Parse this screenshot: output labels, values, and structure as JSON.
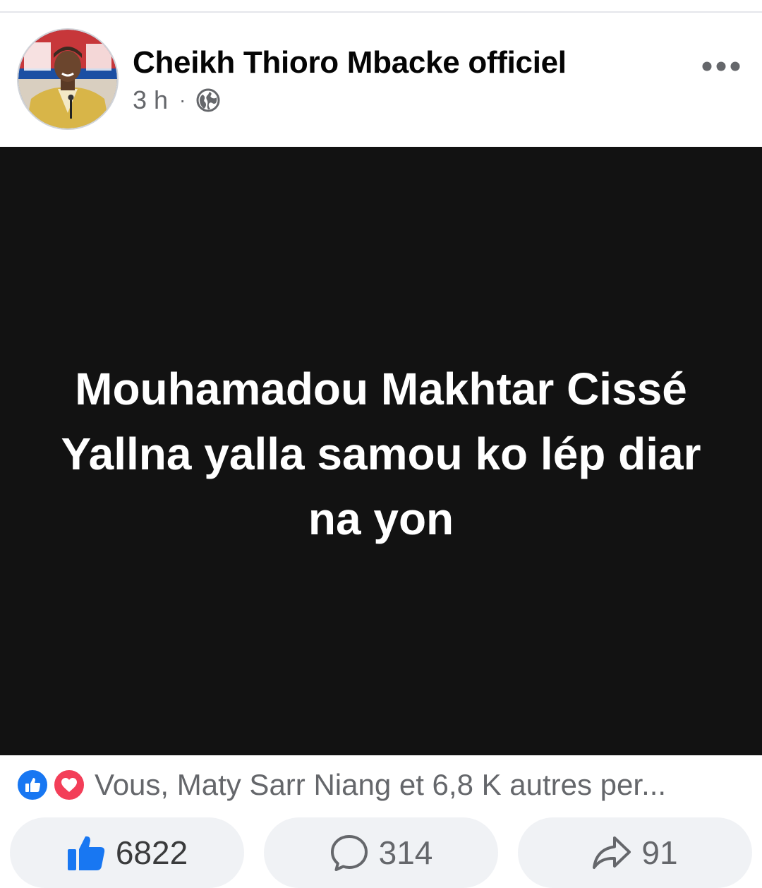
{
  "post": {
    "author_name": "Cheikh Thioro Mbacke officiel",
    "time_ago": "3 h",
    "meta_separator": "·",
    "privacy_icon": "globe-icon",
    "more_icon": "more-options-icon",
    "text_lines": [
      "Mouhamadou Makhtar Cissé",
      "Yallna yalla samou ko lép diar",
      "na yon"
    ],
    "background_color": "#121212",
    "text_color": "#ffffff"
  },
  "reactions": {
    "icons": [
      "like-reaction-icon",
      "love-reaction-icon"
    ],
    "summary": "Vous, Maty Sarr Niang et 6,8 K autres per..."
  },
  "actions": {
    "like_count": "6822",
    "comment_count": "314",
    "share_count": "91"
  },
  "colors": {
    "facebook_blue": "#1877f2",
    "love_red": "#f33e58",
    "secondary_text": "#65676b",
    "button_background": "#f0f2f5"
  }
}
